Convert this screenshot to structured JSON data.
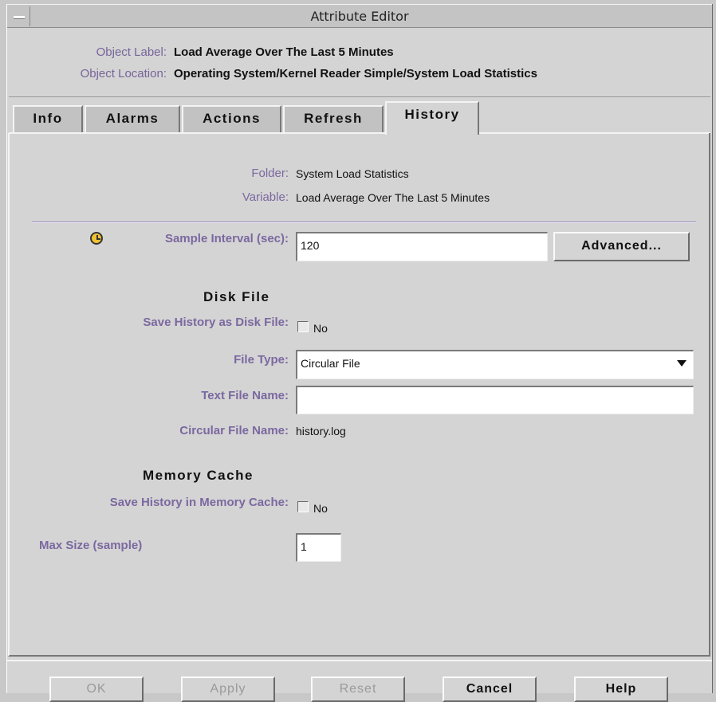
{
  "window": {
    "title": "Attribute Editor"
  },
  "object": {
    "label_key": "Object Label:",
    "label_value": "Load Average Over The Last 5 Minutes",
    "location_key": "Object Location:",
    "location_value": "Operating System/Kernel Reader Simple/System Load Statistics"
  },
  "tabs": [
    {
      "label": "Info"
    },
    {
      "label": "Alarms"
    },
    {
      "label": "Actions"
    },
    {
      "label": "Refresh"
    },
    {
      "label": "History",
      "active": true
    }
  ],
  "history": {
    "folder_label": "Folder:",
    "folder_value": "System Load Statistics",
    "variable_label": "Variable:",
    "variable_value": "Load Average Over The Last 5 Minutes",
    "sample_interval_label": "Sample Interval (sec):",
    "sample_interval_value": "120",
    "advanced_button": "Advanced...",
    "disk_section": "Disk File",
    "save_disk_label": "Save History as Disk File:",
    "save_disk_value": "No",
    "file_type_label": "File Type:",
    "file_type_value": "Circular File",
    "text_file_label": "Text File Name:",
    "text_file_value": "",
    "circular_file_label": "Circular File Name:",
    "circular_file_value": "history.log",
    "memory_section": "Memory Cache",
    "save_memory_label": "Save History in Memory Cache:",
    "save_memory_value": "No",
    "max_size_label": "Max Size (sample)",
    "max_size_value": "1"
  },
  "buttons": {
    "ok": "OK",
    "apply": "Apply",
    "reset": "Reset",
    "cancel": "Cancel",
    "help": "Help"
  },
  "icons": {
    "sample_interval": "clock-icon",
    "window_menu": "window-menu-icon"
  },
  "colors": {
    "label": "#7b68a0",
    "background": "#d4d4d4"
  }
}
